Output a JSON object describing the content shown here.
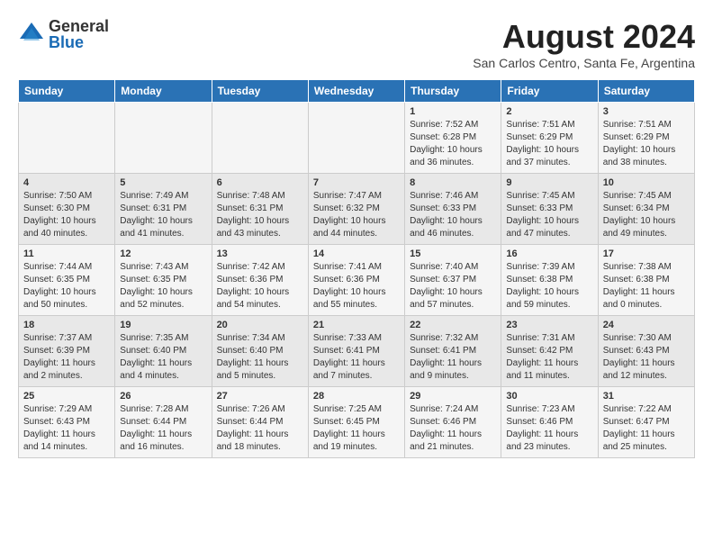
{
  "header": {
    "logo_general": "General",
    "logo_blue": "Blue",
    "month_year": "August 2024",
    "location": "San Carlos Centro, Santa Fe, Argentina"
  },
  "days_of_week": [
    "Sunday",
    "Monday",
    "Tuesday",
    "Wednesday",
    "Thursday",
    "Friday",
    "Saturday"
  ],
  "weeks": [
    [
      {
        "day": "",
        "content": ""
      },
      {
        "day": "",
        "content": ""
      },
      {
        "day": "",
        "content": ""
      },
      {
        "day": "",
        "content": ""
      },
      {
        "day": "1",
        "content": "Sunrise: 7:52 AM\nSunset: 6:28 PM\nDaylight: 10 hours\nand 36 minutes."
      },
      {
        "day": "2",
        "content": "Sunrise: 7:51 AM\nSunset: 6:29 PM\nDaylight: 10 hours\nand 37 minutes."
      },
      {
        "day": "3",
        "content": "Sunrise: 7:51 AM\nSunset: 6:29 PM\nDaylight: 10 hours\nand 38 minutes."
      }
    ],
    [
      {
        "day": "4",
        "content": "Sunrise: 7:50 AM\nSunset: 6:30 PM\nDaylight: 10 hours\nand 40 minutes."
      },
      {
        "day": "5",
        "content": "Sunrise: 7:49 AM\nSunset: 6:31 PM\nDaylight: 10 hours\nand 41 minutes."
      },
      {
        "day": "6",
        "content": "Sunrise: 7:48 AM\nSunset: 6:31 PM\nDaylight: 10 hours\nand 43 minutes."
      },
      {
        "day": "7",
        "content": "Sunrise: 7:47 AM\nSunset: 6:32 PM\nDaylight: 10 hours\nand 44 minutes."
      },
      {
        "day": "8",
        "content": "Sunrise: 7:46 AM\nSunset: 6:33 PM\nDaylight: 10 hours\nand 46 minutes."
      },
      {
        "day": "9",
        "content": "Sunrise: 7:45 AM\nSunset: 6:33 PM\nDaylight: 10 hours\nand 47 minutes."
      },
      {
        "day": "10",
        "content": "Sunrise: 7:45 AM\nSunset: 6:34 PM\nDaylight: 10 hours\nand 49 minutes."
      }
    ],
    [
      {
        "day": "11",
        "content": "Sunrise: 7:44 AM\nSunset: 6:35 PM\nDaylight: 10 hours\nand 50 minutes."
      },
      {
        "day": "12",
        "content": "Sunrise: 7:43 AM\nSunset: 6:35 PM\nDaylight: 10 hours\nand 52 minutes."
      },
      {
        "day": "13",
        "content": "Sunrise: 7:42 AM\nSunset: 6:36 PM\nDaylight: 10 hours\nand 54 minutes."
      },
      {
        "day": "14",
        "content": "Sunrise: 7:41 AM\nSunset: 6:36 PM\nDaylight: 10 hours\nand 55 minutes."
      },
      {
        "day": "15",
        "content": "Sunrise: 7:40 AM\nSunset: 6:37 PM\nDaylight: 10 hours\nand 57 minutes."
      },
      {
        "day": "16",
        "content": "Sunrise: 7:39 AM\nSunset: 6:38 PM\nDaylight: 10 hours\nand 59 minutes."
      },
      {
        "day": "17",
        "content": "Sunrise: 7:38 AM\nSunset: 6:38 PM\nDaylight: 11 hours\nand 0 minutes."
      }
    ],
    [
      {
        "day": "18",
        "content": "Sunrise: 7:37 AM\nSunset: 6:39 PM\nDaylight: 11 hours\nand 2 minutes."
      },
      {
        "day": "19",
        "content": "Sunrise: 7:35 AM\nSunset: 6:40 PM\nDaylight: 11 hours\nand 4 minutes."
      },
      {
        "day": "20",
        "content": "Sunrise: 7:34 AM\nSunset: 6:40 PM\nDaylight: 11 hours\nand 5 minutes."
      },
      {
        "day": "21",
        "content": "Sunrise: 7:33 AM\nSunset: 6:41 PM\nDaylight: 11 hours\nand 7 minutes."
      },
      {
        "day": "22",
        "content": "Sunrise: 7:32 AM\nSunset: 6:41 PM\nDaylight: 11 hours\nand 9 minutes."
      },
      {
        "day": "23",
        "content": "Sunrise: 7:31 AM\nSunset: 6:42 PM\nDaylight: 11 hours\nand 11 minutes."
      },
      {
        "day": "24",
        "content": "Sunrise: 7:30 AM\nSunset: 6:43 PM\nDaylight: 11 hours\nand 12 minutes."
      }
    ],
    [
      {
        "day": "25",
        "content": "Sunrise: 7:29 AM\nSunset: 6:43 PM\nDaylight: 11 hours\nand 14 minutes."
      },
      {
        "day": "26",
        "content": "Sunrise: 7:28 AM\nSunset: 6:44 PM\nDaylight: 11 hours\nand 16 minutes."
      },
      {
        "day": "27",
        "content": "Sunrise: 7:26 AM\nSunset: 6:44 PM\nDaylight: 11 hours\nand 18 minutes."
      },
      {
        "day": "28",
        "content": "Sunrise: 7:25 AM\nSunset: 6:45 PM\nDaylight: 11 hours\nand 19 minutes."
      },
      {
        "day": "29",
        "content": "Sunrise: 7:24 AM\nSunset: 6:46 PM\nDaylight: 11 hours\nand 21 minutes."
      },
      {
        "day": "30",
        "content": "Sunrise: 7:23 AM\nSunset: 6:46 PM\nDaylight: 11 hours\nand 23 minutes."
      },
      {
        "day": "31",
        "content": "Sunrise: 7:22 AM\nSunset: 6:47 PM\nDaylight: 11 hours\nand 25 minutes."
      }
    ]
  ]
}
